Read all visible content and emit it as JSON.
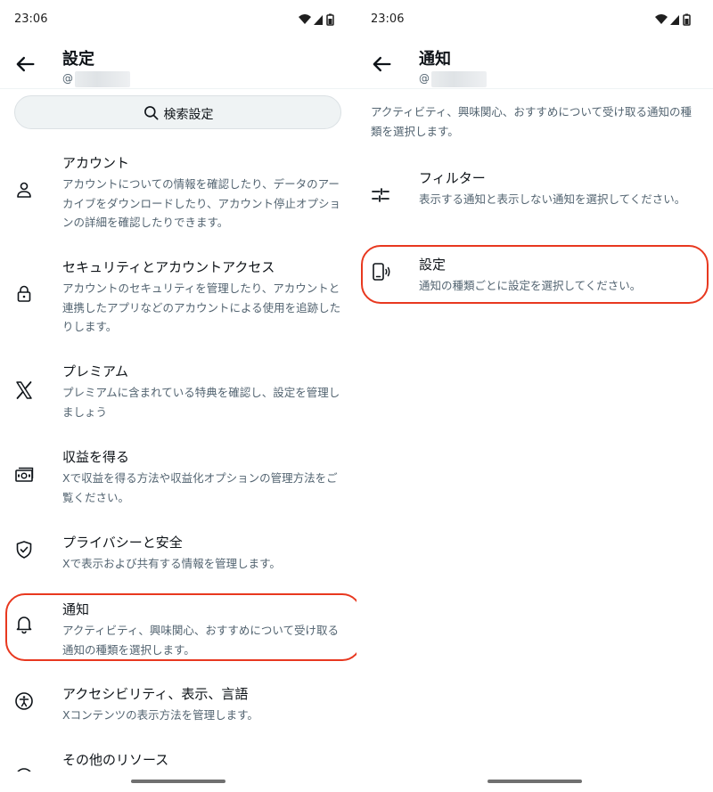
{
  "left": {
    "status_time": "23:06",
    "title": "設定",
    "handle_prefix": "@",
    "search_placeholder": "検索設定",
    "items": [
      {
        "icon": "account-icon",
        "title": "アカウント",
        "desc": "アカウントについての情報を確認したり、データのアーカイブをダウンロードしたり、アカウント停止オプションの詳細を確認したりできます。"
      },
      {
        "icon": "lock-icon",
        "title": "セキュリティとアカウントアクセス",
        "desc": "アカウントのセキュリティを管理したり、アカウントと連携したアプリなどのアカウントによる使用を追跡したりします。"
      },
      {
        "icon": "x-logo-icon",
        "title": "プレミアム",
        "desc": "プレミアムに含まれている特典を確認し、設定を管理しましょう"
      },
      {
        "icon": "money-icon",
        "title": "収益を得る",
        "desc": "Xで収益を得る方法や収益化オプションの管理方法をご覧ください。"
      },
      {
        "icon": "shield-check-icon",
        "title": "プライバシーと安全",
        "desc": "Xで表示および共有する情報を管理します。"
      },
      {
        "icon": "bell-icon",
        "title": "通知",
        "desc": "アクティビティ、興味関心、おすすめについて受け取る通知の種類を選択します。"
      },
      {
        "icon": "accessibility-icon",
        "title": "アクセシビリティ、表示、言語",
        "desc": "Xコンテンツの表示方法を管理します。"
      },
      {
        "icon": "more-resources-icon",
        "title": "その他のリソース",
        "desc": ""
      }
    ]
  },
  "right": {
    "status_time": "23:06",
    "title": "通知",
    "handle_prefix": "@",
    "intro": "アクティビティ、興味関心、おすすめについて受け取る通知の種類を選択します。",
    "items": [
      {
        "icon": "filter-sliders-icon",
        "title": "フィルター",
        "desc": "表示する通知と表示しない通知を選択してください。"
      },
      {
        "icon": "device-sound-icon",
        "title": "設定",
        "desc": "通知の種類ごとに設定を選択してください。"
      }
    ]
  },
  "colors": {
    "highlight": "#e8381f",
    "text": "#0f1419",
    "secondary": "#536471"
  }
}
